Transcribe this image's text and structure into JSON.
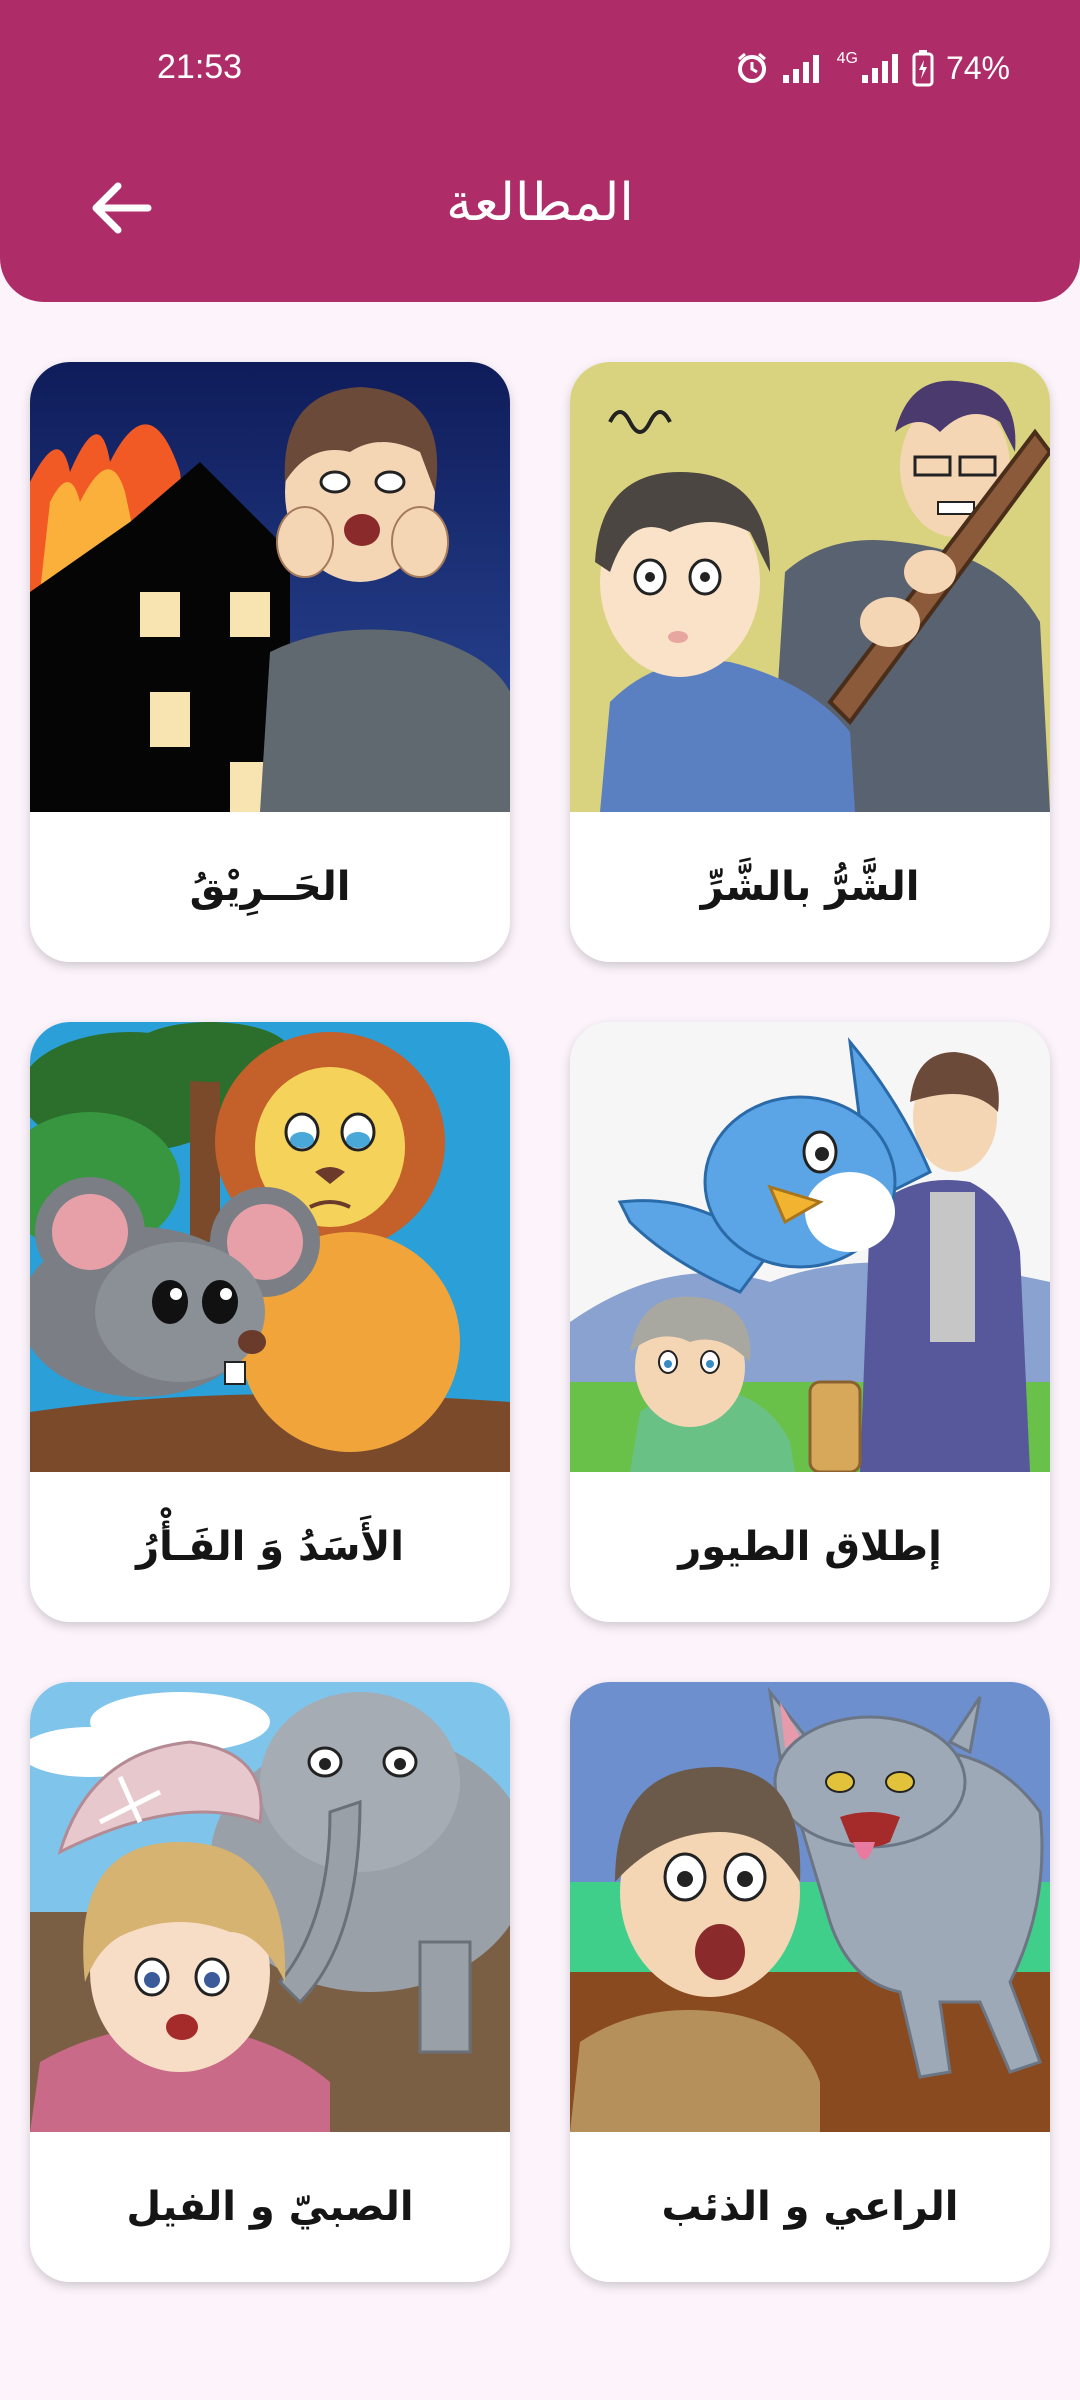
{
  "status": {
    "time": "21:53",
    "network": "4G",
    "battery": "74%",
    "icons": [
      "alarm-icon",
      "signal-icon",
      "4g-signal-icon",
      "battery-charging-icon"
    ]
  },
  "header": {
    "title": "المطالعة",
    "back_icon": "arrow-left-icon",
    "color": "#ae2d69"
  },
  "stories": [
    {
      "label": "الشَّرُّ بالشَّرِّ",
      "image": "man-with-club-and-boy"
    },
    {
      "label": "الحَــرِيْقُ",
      "image": "burning-house-and-scared-man"
    },
    {
      "label": "إطلاق الطيور",
      "image": "blue-bird-man-and-boy"
    },
    {
      "label": "الأَسَدُ وَ الفَـأْرُ",
      "image": "crying-lion-and-mouse"
    },
    {
      "label": "الراعي و الذئب",
      "image": "wolf-and-shepherd-boy"
    },
    {
      "label": "الصبيّ و الفيل",
      "image": "girl-and-elephant"
    }
  ]
}
